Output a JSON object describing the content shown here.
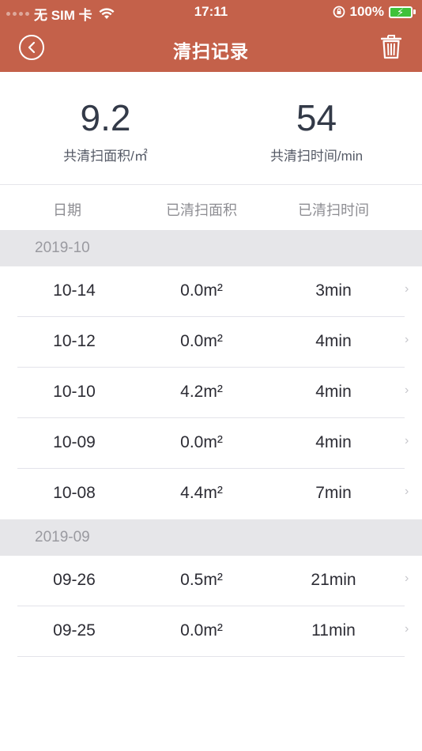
{
  "status_bar": {
    "carrier": "无 SIM 卡",
    "time": "17:11",
    "battery": "100%"
  },
  "nav": {
    "title": "清扫记录"
  },
  "summary": {
    "area_value": "9.2",
    "area_label": "共清扫面积/㎡",
    "time_value": "54",
    "time_label": "共清扫时间/min"
  },
  "columns": {
    "date": "日期",
    "area": "已清扫面积",
    "time": "已清扫时间"
  },
  "groups": [
    {
      "month": "2019-10",
      "rows": [
        {
          "date": "10-14",
          "area": "0.0m²",
          "time": "3min"
        },
        {
          "date": "10-12",
          "area": "0.0m²",
          "time": "4min"
        },
        {
          "date": "10-10",
          "area": "4.2m²",
          "time": "4min"
        },
        {
          "date": "10-09",
          "area": "0.0m²",
          "time": "4min"
        },
        {
          "date": "10-08",
          "area": "4.4m²",
          "time": "7min"
        }
      ]
    },
    {
      "month": "2019-09",
      "rows": [
        {
          "date": "09-26",
          "area": "0.5m²",
          "time": "21min"
        },
        {
          "date": "09-25",
          "area": "0.0m²",
          "time": "11min"
        }
      ]
    }
  ],
  "colors": {
    "header_bg": "#c4614a",
    "group_bg": "#e6e6e9",
    "battery_fill": "#3ec23a"
  },
  "chevron_glyph": "›"
}
